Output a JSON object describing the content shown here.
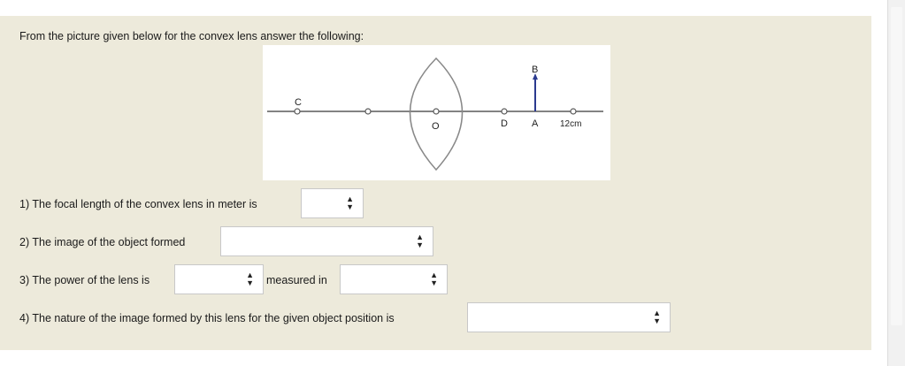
{
  "instruction": "From the picture given below for the convex lens answer the following:",
  "figure": {
    "labels": {
      "C": "C",
      "O": "O",
      "D": "D",
      "A": "A",
      "B": "B",
      "distance": "12cm"
    }
  },
  "questions": {
    "q1": "1) The focal length of the convex lens in meter is",
    "q2": "2) The image of the object formed",
    "q3": "3) The power of the lens is",
    "q3_unit": "measured in",
    "q4": "4) The nature of the image formed by this lens for the given object position is"
  },
  "dropdowns": {
    "q1_value": "",
    "q2_value": "",
    "q3_value": "",
    "q3_unit_value": "",
    "q4_value": ""
  },
  "icons": {
    "dropdown": "up-down-arrows"
  },
  "colors": {
    "panel": "#edeadb",
    "ray": "#2b3a8f"
  }
}
